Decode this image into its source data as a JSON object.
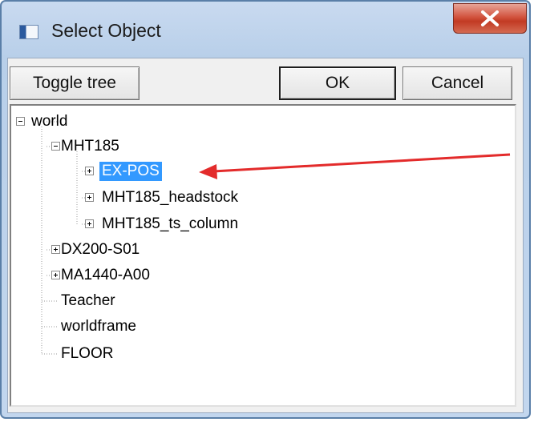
{
  "window": {
    "title": "Select Object",
    "close_glyph": "x"
  },
  "toolbar": {
    "toggle_tree_label": "Toggle tree",
    "ok_label": "OK",
    "cancel_label": "Cancel"
  },
  "tree": {
    "nodes": [
      {
        "label": "world",
        "level": 0,
        "expander": "minus"
      },
      {
        "label": "MHT185",
        "level": 1,
        "expander": "minus"
      },
      {
        "label": "EX-POS",
        "level": 2,
        "expander": "plus",
        "selected": true
      },
      {
        "label": "MHT185_headstock",
        "level": 2,
        "expander": "plus"
      },
      {
        "label": "MHT185_ts_column",
        "level": 2,
        "expander": "plus"
      },
      {
        "label": "DX200-S01",
        "level": 1,
        "expander": "plus"
      },
      {
        "label": "MA1440-A00",
        "level": 1,
        "expander": "plus"
      },
      {
        "label": "Teacher",
        "level": 1,
        "expander": "none"
      },
      {
        "label": "worldframe",
        "level": 1,
        "expander": "none"
      },
      {
        "label": "FLOOR",
        "level": 1,
        "expander": "none"
      }
    ]
  },
  "colors": {
    "selection": "#3399ff",
    "annotation_arrow": "#e32b2b",
    "close_button": "#c94b35"
  },
  "icons": {
    "app": "window-app-icon",
    "close": "close-icon",
    "expand": "plus-box-icon",
    "collapse": "minus-box-icon"
  }
}
